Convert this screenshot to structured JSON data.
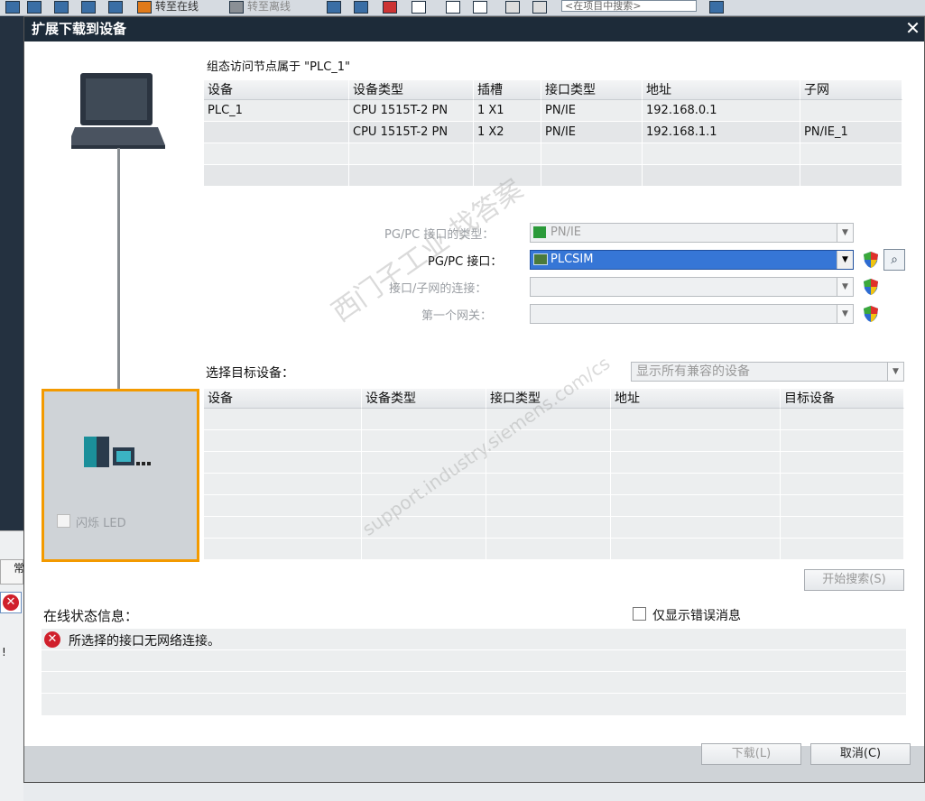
{
  "background": {
    "toolbar": {
      "go_online": "转至在线",
      "go_offline": "转至离线",
      "search_placeholder": "<在项目中搜索>"
    },
    "left_tab": "常",
    "left_excl": "!"
  },
  "dialog": {
    "title": "扩展下载到设备",
    "configured_label": "组态访问节点属于 \"PLC_1\"",
    "config_table": {
      "headers": [
        "设备",
        "设备类型",
        "插槽",
        "接口类型",
        "地址",
        "子网"
      ],
      "rows": [
        [
          "PLC_1",
          "CPU 1515T-2 PN",
          "1 X1",
          "PN/IE",
          "192.168.0.1",
          ""
        ],
        [
          "",
          "CPU 1515T-2 PN",
          "1 X2",
          "PN/IE",
          "192.168.1.1",
          "PN/IE_1"
        ],
        [
          "",
          "",
          "",
          "",
          "",
          ""
        ],
        [
          "",
          "",
          "",
          "",
          "",
          ""
        ]
      ]
    },
    "pgpc_type_label": "PG/PC 接口的类型：",
    "pgpc_type_value": "PN/IE",
    "pgpc_interface_label": "PG/PC 接口：",
    "pgpc_interface_value": "PLCSIM",
    "subnet_conn_label": "接口/子网的连接：",
    "gateway_label": "第一个网关：",
    "select_target_label": "选择目标设备：",
    "target_filter_value": "显示所有兼容的设备",
    "target_table": {
      "headers": [
        "设备",
        "设备类型",
        "接口类型",
        "地址",
        "目标设备"
      ]
    },
    "flash_led_label": "闪烁 LED",
    "start_search_button": "开始搜索(S)",
    "online_status_label": "在线状态信息：",
    "only_errors_label": "仅显示错误消息",
    "status_messages": [
      "所选择的接口无网络连接。"
    ],
    "load_button": "下载(L)",
    "cancel_button": "取消(C)",
    "watermark": "西门子工业 找答案",
    "watermark_url": "support.industry.siemens.com/cs"
  },
  "colors": {
    "titlebar": "#1d2b39",
    "selection": "#3676d6",
    "highlight_frame": "#f39a00",
    "error": "#d0202c"
  }
}
